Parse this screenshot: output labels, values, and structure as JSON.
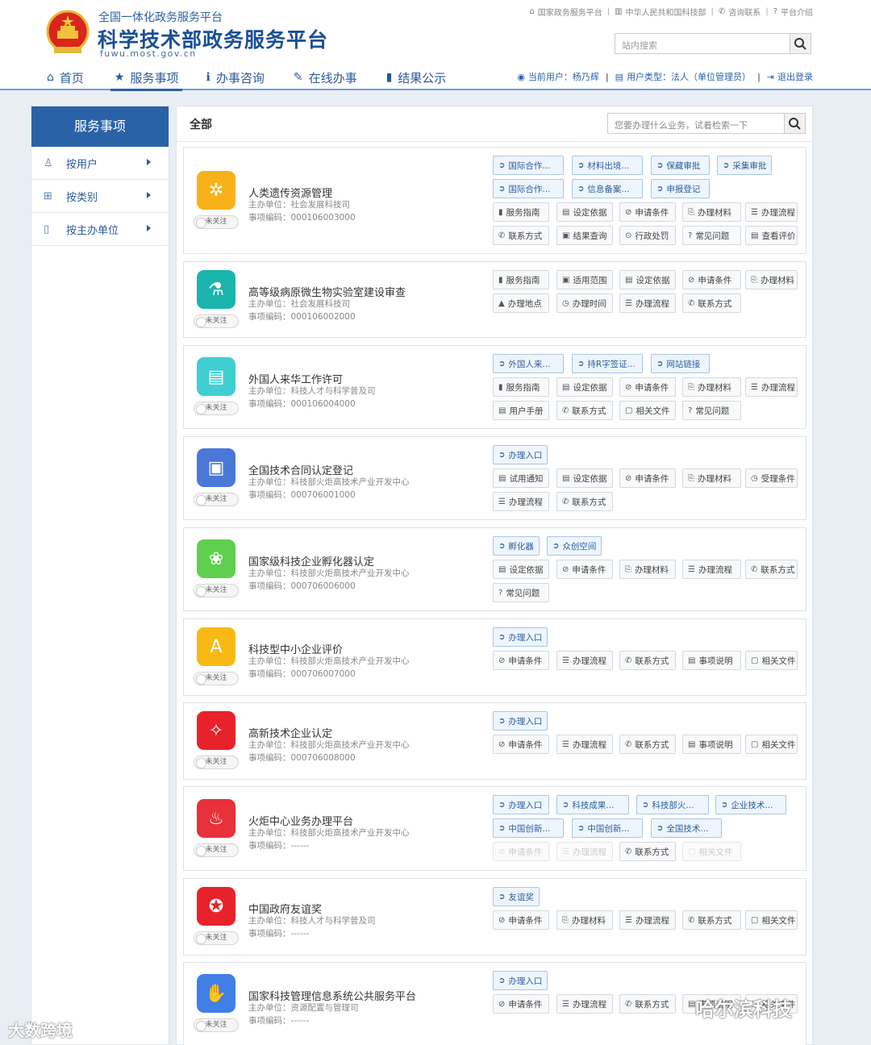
{
  "header": {
    "subtitle": "全国一体化政务服务平台",
    "title": "科学技术部政务服务平台",
    "domain": "fuwu.most.gov.cn",
    "top_links": [
      "国家政务服务平台",
      "中华人民共和国科技部",
      "咨询联系",
      "平台介绍"
    ],
    "search_placeholder": "站内搜索",
    "nav": [
      "首页",
      "服务事项",
      "办事咨询",
      "在线办事",
      "结果公示"
    ],
    "current_user_label": "当前用户：杨乃辉",
    "user_type_label": "用户类型：法人（单位管理员）",
    "logout": "退出登录"
  },
  "sidebar": {
    "title": "服务事项",
    "items": [
      "按用户",
      "按类别",
      "按主办单位"
    ]
  },
  "main": {
    "heading": "全部",
    "search_placeholder": "您要办理什么业务，试着检索一下"
  },
  "follow_label": "未关注",
  "cards": [
    {
      "title": "人类遗传资源管理",
      "unit": "主办单位：社会发展科技司",
      "code": "事项编码：000106003000",
      "icon": "dna-icon",
      "color": "#f7b21a",
      "tags": [
        "国际合作...",
        "材料出境...",
        "保藏审批",
        "采集审批",
        "国际合作...",
        "信息备案...",
        "申报登记",
        "服务指南",
        "设定依据",
        "申请条件",
        "办理材料",
        "办理流程",
        "联系方式",
        "结果查询",
        "行政处罚",
        "常见问题",
        "查看评价"
      ]
    },
    {
      "title": "高等级病原微生物实验室建设审查",
      "unit": "主办单位：社会发展科技司",
      "code": "事项编码：000106002000",
      "icon": "flask-icon",
      "color": "#1bb5ad",
      "tags": [
        "服务指南",
        "适用范围",
        "设定依据",
        "申请条件",
        "办理材料",
        "办理地点",
        "办理时间",
        "办理流程",
        "联系方式"
      ]
    },
    {
      "title": "外国人来华工作许可",
      "unit": "主办单位：科技人才与科学普及司",
      "code": "事项编码：000106004000",
      "icon": "id-card-icon",
      "color": "#3fcfd0",
      "tags": [
        "外国人来...",
        "持R字签证...",
        "网站链接",
        "服务指南",
        "设定依据",
        "申请条件",
        "办理材料",
        "办理流程",
        "用户手册",
        "联系方式",
        "相关文件",
        "常见问题"
      ]
    },
    {
      "title": "全国技术合同认定登记",
      "unit": "主办单位：科技部火炬高技术产业开发中心",
      "code": "事项编码：000706001000",
      "icon": "contract-icon",
      "color": "#4a78d8",
      "tags": [
        "办理入口",
        "试用通知",
        "设定依据",
        "申请条件",
        "办理材料",
        "受理条件",
        "办理流程",
        "联系方式"
      ]
    },
    {
      "title": "国家级科技企业孵化器认定",
      "unit": "主办单位：科技部火炬高技术产业开发中心",
      "code": "事项编码：000706006000",
      "icon": "hands-icon",
      "color": "#5fcf4f",
      "tags": [
        "孵化器",
        "众创空间",
        "设定依据",
        "申请条件",
        "办理材料",
        "办理流程",
        "联系方式",
        "常见问题"
      ]
    },
    {
      "title": "科技型中小企业评价",
      "unit": "主办单位：科技部火炬高技术产业开发中心",
      "code": "事项编码：000706007000",
      "icon": "grade-icon",
      "color": "#f9b915",
      "tags": [
        "办理入口",
        "申请条件",
        "办理流程",
        "联系方式",
        "事项说明",
        "相关文件"
      ]
    },
    {
      "title": "高新技术企业认定",
      "unit": "主办单位：科技部火炬高技术产业开发中心",
      "code": "事项编码：000706008000",
      "icon": "leaf-icon",
      "color": "#e8222b",
      "tags": [
        "办理入口",
        "申请条件",
        "办理流程",
        "联系方式",
        "事项说明",
        "相关文件"
      ]
    },
    {
      "title": "火炬中心业务办理平台",
      "unit": "主办单位：科技部火炬高技术产业开发中心",
      "code": "事项编码：------",
      "icon": "torch-icon",
      "color": "#e8313a",
      "tags": [
        "办理入口",
        "科技成果...",
        "科技部火...",
        "企业技术...",
        "中国创新...",
        "中国创新...",
        "全国技术...",
        "申请条件",
        "办理流程",
        "联系方式",
        "相关文件"
      ]
    },
    {
      "title": "中国政府友谊奖",
      "unit": "主办单位：科技人才与科学普及司",
      "code": "事项编码：------",
      "icon": "medal-icon",
      "color": "#e8222b",
      "tags": [
        "友谊奖",
        "申请条件",
        "办理材料",
        "办理流程",
        "联系方式",
        "相关文件"
      ]
    },
    {
      "title": "国家科技管理信息系统公共服务平台",
      "unit": "主办单位：资源配置与管理司",
      "code": "事项编码：------",
      "icon": "handshake-icon",
      "color": "#3f7fe6",
      "tags": [
        "办理入口",
        "申请条件",
        "办理流程",
        "联系方式",
        "事项说明",
        "相关文件"
      ]
    }
  ],
  "watermarks": {
    "left": "大数跨境",
    "right": "哈尔滨科技"
  }
}
